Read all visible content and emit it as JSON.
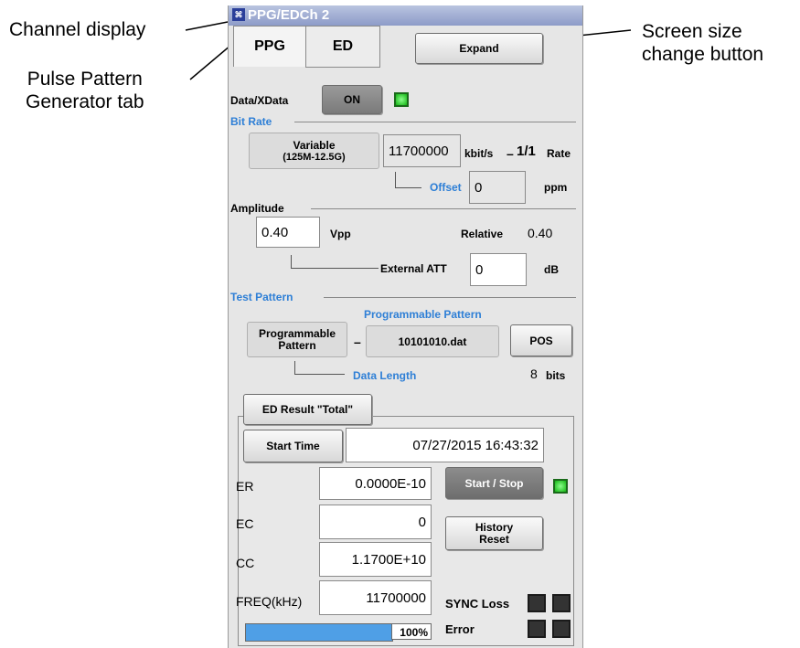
{
  "callouts": {
    "channel_display": "Channel display",
    "ppg_tab_line1": "Pulse Pattern",
    "ppg_tab_line2": "Generator tab",
    "screen_size_line1": "Screen size",
    "screen_size_line2": "change button"
  },
  "window": {
    "title": "PPG/EDCh 2",
    "icon": "app-icon"
  },
  "tabs": {
    "ppg": "PPG",
    "ed": "ED",
    "active": "PPG"
  },
  "toolbar": {
    "expand_label": "Expand"
  },
  "data_xdata": {
    "label": "Data/XData",
    "button": "ON",
    "led": "on"
  },
  "bit_rate": {
    "section": "Bit Rate",
    "mode_line1": "Variable",
    "mode_line2": "(125M-12.5G)",
    "value": "11700000",
    "unit": "kbit/s",
    "dash": "–",
    "ratio": "1/1",
    "rate_label": "Rate",
    "offset_label": "Offset",
    "offset_value": "0",
    "offset_unit": "ppm"
  },
  "amplitude": {
    "section": "Amplitude",
    "value": "0.40",
    "unit": "Vpp",
    "relative_label": "Relative",
    "relative_value": "0.40",
    "external_att_label": "External ATT",
    "external_att_value": "0",
    "external_att_unit": "dB"
  },
  "test_pattern": {
    "section": "Test Pattern",
    "programmable_header": "Programmable Pattern",
    "type_line1": "Programmable",
    "type_line2": "Pattern",
    "dash": "–",
    "file": "10101010.dat",
    "pos_button": "POS",
    "data_length_label": "Data Length",
    "data_length_value": "8",
    "data_length_unit": "bits"
  },
  "ed_result": {
    "button": "ED Result \"Total\"",
    "start_time_button": "Start Time",
    "start_time_value": "07/27/2015 16:43:32",
    "er_label": "ER",
    "er_value": "0.0000E-10",
    "ec_label": "EC",
    "ec_value": "0",
    "cc_label": "CC",
    "cc_value": "1.1700E+10",
    "freq_label": "FREQ(kHz)",
    "freq_value": "11700000",
    "start_stop_button": "Start / Stop",
    "start_stop_led": "on",
    "history_line1": "History",
    "history_line2": "Reset",
    "sync_loss_label": "SYNC Loss",
    "error_label": "Error",
    "progress_percent": 100,
    "progress_text": "100%"
  },
  "colors": {
    "accent_blue": "#2e7fd6",
    "led_green": "#12b312",
    "progress_blue": "#4f9fe6"
  }
}
